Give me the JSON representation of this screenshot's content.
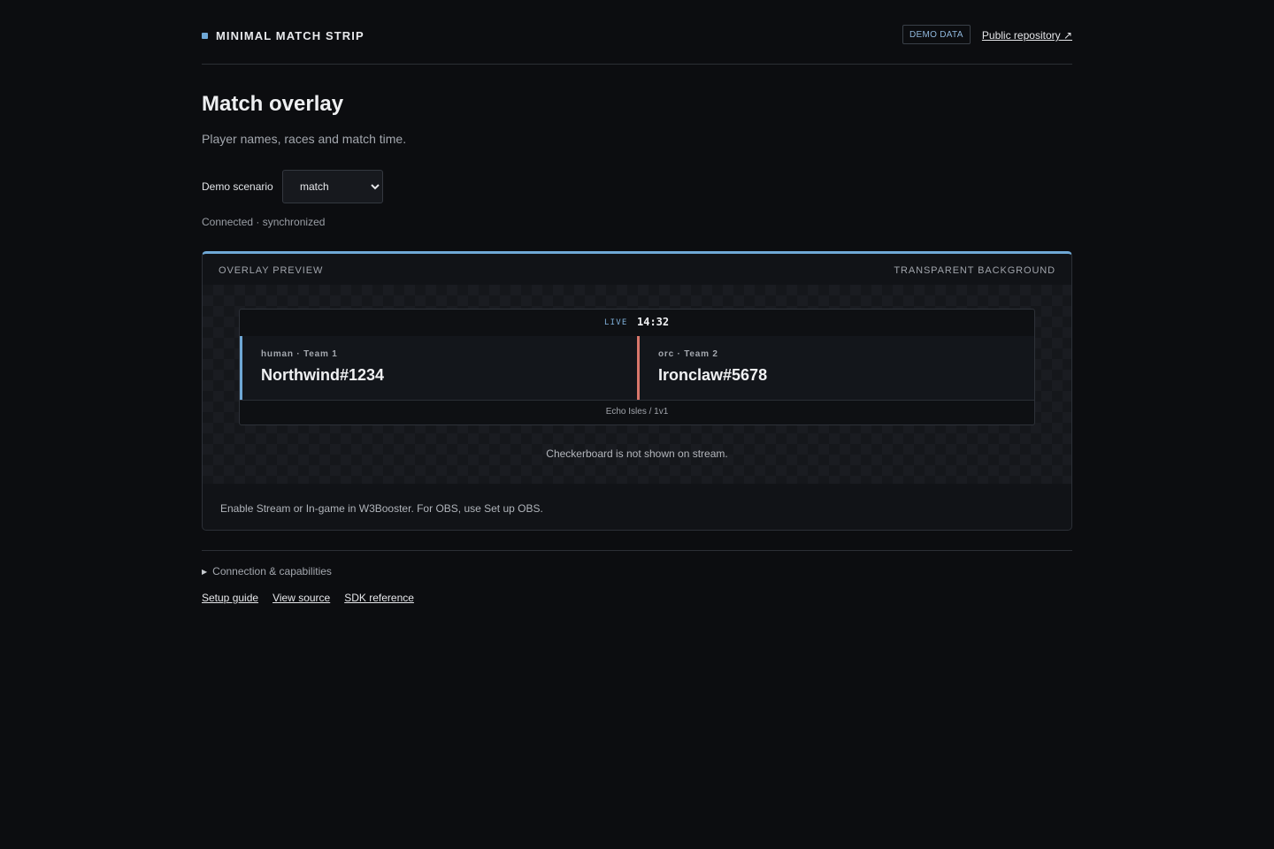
{
  "header": {
    "brand_title": "MINIMAL MATCH STRIP",
    "demo_badge": "DEMO DATA",
    "repo_link": "Public repository ↗"
  },
  "page": {
    "title": "Match overlay",
    "subtitle": "Player names, races and match time."
  },
  "controls": {
    "scenario_label": "Demo scenario",
    "scenario_selected": "match",
    "status": "Connected · synchronized"
  },
  "preview": {
    "header_left": "OVERLAY PREVIEW",
    "header_right": "TRANSPARENT BACKGROUND",
    "strip": {
      "live_label": "LIVE",
      "timer": "14:32",
      "players": [
        {
          "meta": "human · Team 1",
          "name": "Northwind#1234",
          "color": "#6fa8d6"
        },
        {
          "meta": "orc · Team 2",
          "name": "Ironclaw#5678",
          "color": "#d9776b"
        }
      ],
      "map": "Echo Isles / 1v1"
    },
    "checker_note": "Checkerboard is not shown on stream.",
    "footer_text": "Enable Stream or In-game in W3Booster. For OBS, use Set up OBS."
  },
  "details": {
    "summary": "Connection & capabilities"
  },
  "footer_links": [
    "Setup guide",
    "View source",
    "SDK reference"
  ],
  "colors": {
    "accent": "#6fa8d6",
    "team2": "#d9776b",
    "background": "#0c0d10"
  }
}
